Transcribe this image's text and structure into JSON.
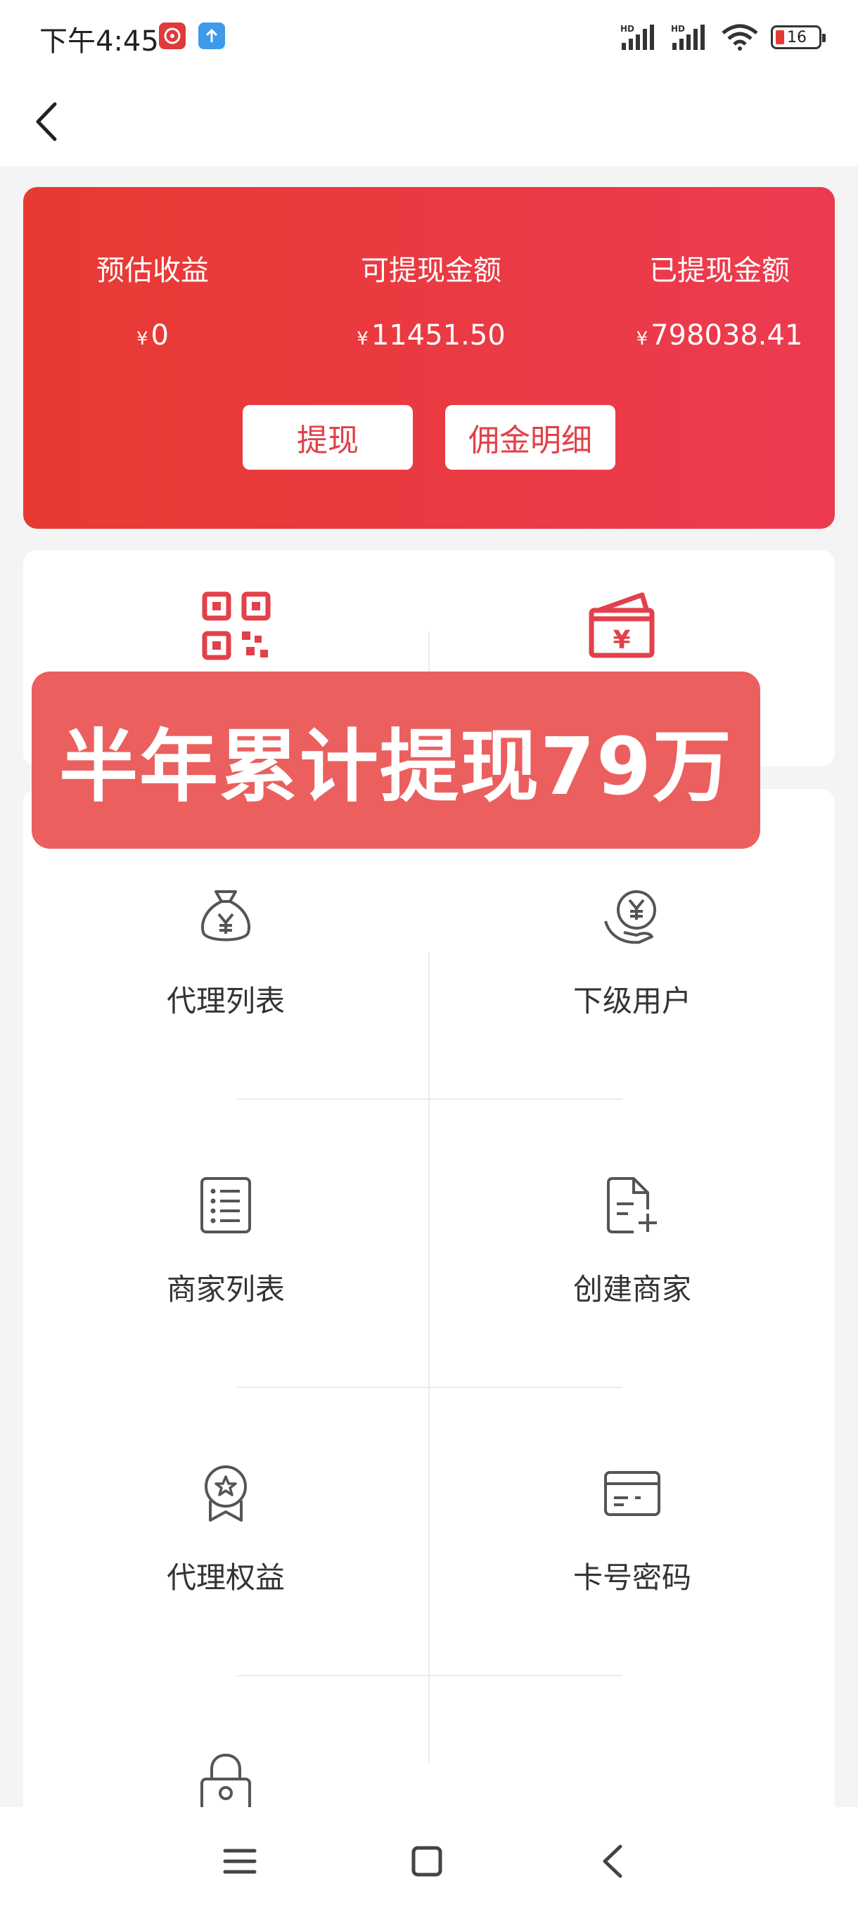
{
  "status_bar": {
    "time": "下午4:45",
    "battery_level": "16",
    "icons": [
      "red-app-icon",
      "upload-arrow-icon",
      "hd-signal-icon",
      "hd-signal-icon",
      "wifi-icon",
      "battery-icon"
    ]
  },
  "header": {
    "back_icon": "chevron-left-icon"
  },
  "earnings": {
    "stats": [
      {
        "label": "预估收益",
        "currency": "¥",
        "amount": "0"
      },
      {
        "label": "可提现金额",
        "currency": "¥",
        "amount": "11451.50"
      },
      {
        "label": "已提现金额",
        "currency": "¥",
        "amount": "798038.41"
      }
    ],
    "withdraw_label": "提现",
    "commission_label": "佣金明细"
  },
  "quick_actions": {
    "icons": [
      "qr-code-icon",
      "wallet-yen-icon"
    ]
  },
  "menu": {
    "items": [
      {
        "label": "代理列表",
        "icon": "money-bag-icon"
      },
      {
        "label": "下级用户",
        "icon": "yen-hand-icon"
      },
      {
        "label": "商家列表",
        "icon": "list-icon"
      },
      {
        "label": "创建商家",
        "icon": "document-add-icon"
      },
      {
        "label": "代理权益",
        "icon": "badge-star-icon"
      },
      {
        "label": "卡号密码",
        "icon": "card-icon"
      },
      {
        "label": "",
        "icon": "lock-icon"
      }
    ]
  },
  "promo_banner": {
    "text": "半年累计提现79万"
  },
  "colors": {
    "card_gradient_start": "#e83a33",
    "card_gradient_end": "#ec3b50",
    "banner": "#ec5f5f",
    "accent_icon": "#e2404a"
  }
}
